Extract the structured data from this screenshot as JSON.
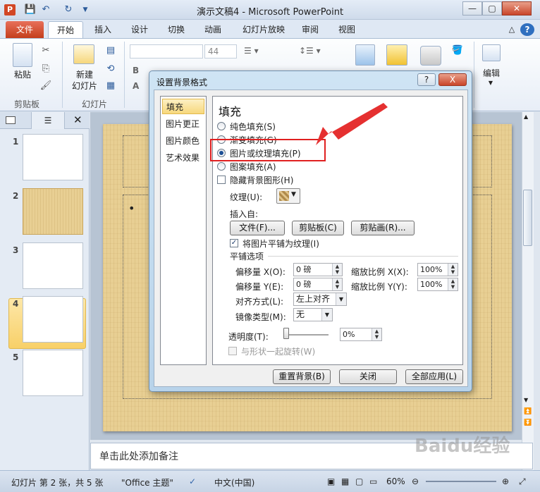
{
  "window": {
    "title": "演示文稿4 - Microsoft PowerPoint",
    "app_icon": "P"
  },
  "tabs": [
    {
      "label": "文件"
    },
    {
      "label": "开始"
    },
    {
      "label": "插入"
    },
    {
      "label": "设计"
    },
    {
      "label": "切换"
    },
    {
      "label": "动画"
    },
    {
      "label": "幻灯片放映"
    },
    {
      "label": "审阅"
    },
    {
      "label": "视图"
    }
  ],
  "ribbon": {
    "paste_label": "粘贴",
    "clipboard_group": "剪贴板",
    "new_slide_label": "新建\n幻灯片",
    "new_slide_line1": "新建",
    "new_slide_line2": "幻灯片",
    "slides_group": "幻灯片",
    "font_size": "44",
    "edit_label": "编辑"
  },
  "slides": [
    {
      "num": "1"
    },
    {
      "num": "2"
    },
    {
      "num": "3"
    },
    {
      "num": "4"
    },
    {
      "num": "5"
    }
  ],
  "notes_placeholder": "单击此处添加备注",
  "status": {
    "slide_info": "幻灯片 第 2 张，共 5 张",
    "theme": "\"Office 主题\"",
    "language": "中文(中国)",
    "zoom": "60%"
  },
  "dialog": {
    "title": "设置背景格式",
    "help": "?",
    "close": "X",
    "categories": [
      "填充",
      "图片更正",
      "图片颜色",
      "艺术效果"
    ],
    "section_title": "填充",
    "options": {
      "solid": "纯色填充(S)",
      "gradient": "渐变填充(G)",
      "picture": "图片或纹理填充(P)",
      "pattern": "图案填充(A)",
      "hide_bg": "隐藏背景图形(H)"
    },
    "texture_label": "纹理(U):",
    "insert_from": "插入自:",
    "btn_file": "文件(F)...",
    "btn_clipboard": "剪贴板(C)",
    "btn_clipart": "剪贴画(R)...",
    "tile_checkbox": "将图片平铺为纹理(I)",
    "tile_options": "平铺选项",
    "offset_x_label": "偏移量 X(O):",
    "offset_x": "0 磅",
    "scale_x_label": "缩放比例 X(X):",
    "scale_x": "100%",
    "offset_y_label": "偏移量 Y(E):",
    "offset_y": "0 磅",
    "scale_y_label": "缩放比例 Y(Y):",
    "scale_y": "100%",
    "align_label": "对齐方式(L):",
    "align_value": "左上对齐",
    "mirror_label": "镜像类型(M):",
    "mirror_value": "无",
    "transparency_label": "透明度(T):",
    "transparency_value": "0%",
    "rotate_label": "与形状一起旋转(W)",
    "btn_reset": "重置背景(B)",
    "btn_close": "关闭",
    "btn_apply_all": "全部应用(L)"
  },
  "watermark": "Baidu经验"
}
